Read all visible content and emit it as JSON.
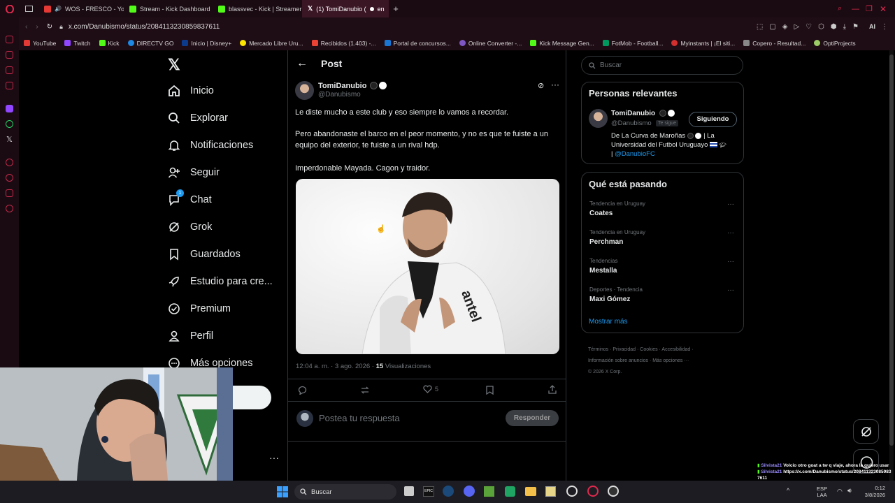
{
  "browser": {
    "tabs": [
      {
        "label": "WOS - FRESCO - YouTu",
        "color": "#e53935"
      },
      {
        "label": "Stream - Kick Dashboard",
        "color": "#53fc18"
      },
      {
        "label": "blassvec - Kick | Streamer",
        "color": "#53fc18"
      },
      {
        "label": "(1) TomiDanubio (",
        "color": "#ffffff"
      },
      {
        "label": "en",
        "color": "#ffffff"
      }
    ],
    "url": "x.com/Danubismo/status/2084113230859837611",
    "bookmarks": [
      "YouTube",
      "Twitch",
      "Kick",
      "DIRECTV GO",
      "Inicio | Disney+",
      "Mercado Libre Uru...",
      "Recibidos (1.403) -...",
      "Portal de concursos...",
      "Online Converter -...",
      "Kick Message Gen...",
      "FotMob - Football...",
      "Myinstants | ¡El siti...",
      "Copero - Resultad...",
      "OptiProjects"
    ]
  },
  "nav": {
    "items": [
      "Inicio",
      "Explorar",
      "Notificaciones",
      "Seguir",
      "Chat",
      "Grok",
      "Guardados",
      "Estudio para cre...",
      "Premium",
      "Perfil",
      "Más opciones"
    ],
    "chat_badge": "1"
  },
  "post": {
    "header_title": "Post",
    "author_name": "TomiDanubio",
    "author_handle": "@Danubismo",
    "text_1": "Le diste mucho a este club y eso siempre lo vamos a recordar.",
    "text_2": "Pero abandonaste el barco en el peor momento, y no es que te fuiste a un equipo del exterior, te fuiste a un rival hdp.",
    "text_3": "Imperdonable Mayada. Cagon y traidor.",
    "image_sponsor": "antel",
    "timestamp": "12:04 a. m. · 3 ago. 2026 ·",
    "views_count": "15",
    "views_label": "Visualizaciones",
    "likes": "5",
    "reply_placeholder": "Postea tu respuesta",
    "reply_button": "Responder"
  },
  "right": {
    "search_placeholder": "Buscar",
    "relevant_title": "Personas relevantes",
    "person_name": "TomiDanubio",
    "person_handle": "@Danubismo",
    "follows_you": "Te sigue",
    "following_button": "Siguiendo",
    "bio_1": "De La Curva de Maroñas",
    "bio_2": "| La",
    "bio_3": "Universidad del Futbol Uruguayo",
    "bio_4": "|",
    "bio_link": "@DanubioFC",
    "trends_title": "Qué está pasando",
    "trends": [
      {
        "context": "Tendencia en Uruguay",
        "name": "Coates"
      },
      {
        "context": "Tendencia en Uruguay",
        "name": "Perchman"
      },
      {
        "context": "Tendencias",
        "name": "Mestalla"
      },
      {
        "context": "Deportes · Tendencia",
        "name": "Maxi Gómez"
      }
    ],
    "show_more": "Mostrar más",
    "footer_1": "Términos · Privacidad · Cookies · Accesibilidad ·",
    "footer_2": "Información sobre anuncios · Más opciones ···",
    "footer_3": "© 2026 X Corp."
  },
  "chat_overlay": {
    "line_1_user": "Silvista21",
    "line_1_text": "Volcio otro goat a tw q viaje, ahora la quiero usar",
    "line_2_user": "Silvista21",
    "line_2_text": "https://x.com/Danubismo/status/2084113230859837611"
  },
  "taskbar": {
    "search": "Buscar",
    "lang_1": "ESP",
    "lang_2": "LAA",
    "time": "0:12",
    "date": "3/8/2026"
  }
}
